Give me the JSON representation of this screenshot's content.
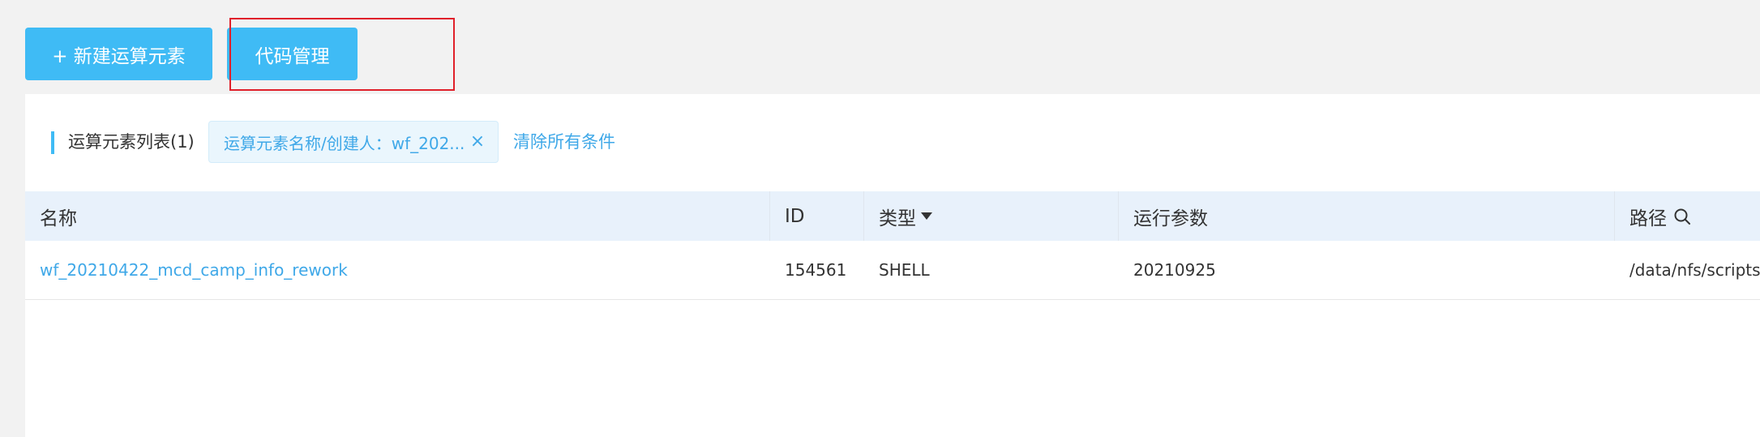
{
  "toolbar": {
    "new_button_label": "+ 新建运算元素",
    "code_button_label": "代码管理"
  },
  "filter": {
    "list_title": "运算元素列表(1)",
    "active_tag": "运算元素名称/创建人：wf_202...",
    "close_glyph": "×",
    "clear_all_label": "清除所有条件"
  },
  "table": {
    "columns": {
      "name": "名称",
      "id": "ID",
      "type": "类型",
      "params": "运行参数",
      "path": "路径"
    },
    "rows": [
      {
        "name": "wf_20210422_mcd_camp_info_rework",
        "id": "154561",
        "type": "SHELL",
        "params": "20210925",
        "path": "/data/nfs/scripts/"
      }
    ]
  },
  "icons": {
    "sort": "caret-down-icon",
    "search": "search-icon"
  },
  "colors": {
    "primary": "#3fbbf5",
    "link": "#3fa8e8",
    "header_bg": "#e8f1fb",
    "highlight": "#e0202a"
  }
}
